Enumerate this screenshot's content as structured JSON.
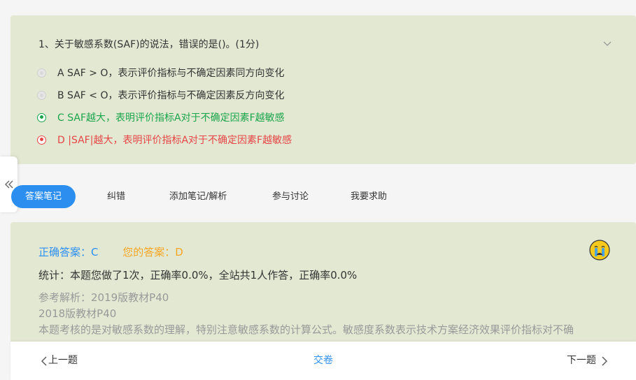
{
  "question": {
    "title": "1、关于敏感系数(SAF)的说法，错误的是()。(1分)",
    "options": [
      {
        "text": "A SAF > O，表示评价指标与不确定因素同方向变化",
        "state": "unselected"
      },
      {
        "text": "B SAF < O，表示评价指标与不确定因素反方向变化",
        "state": "unselected"
      },
      {
        "text": "C SAF越大，表明评价指标A对于不确定因素F越敏感",
        "state": "correct"
      },
      {
        "text": "D |SAF|越大，表明评价指标A对于不确定因素F越敏感",
        "state": "wrong"
      }
    ]
  },
  "tabs": [
    {
      "label": "答案笔记",
      "active": true
    },
    {
      "label": "纠错",
      "active": false
    },
    {
      "label": "添加笔记/解析",
      "active": false
    },
    {
      "label": "参与讨论",
      "active": false
    },
    {
      "label": "我要求助",
      "active": false
    }
  ],
  "answer": {
    "correct_answer": "正确答案：C",
    "your_answer": "您的答案：D",
    "stats": "统计：本题您做了1次，正确率0.0%，全站共1人作答，正确率0.0%",
    "analysis_lines": [
      "参考解析：2019版教材P40",
      "2018版教材P40",
      "本题考核的是对敏感系数的理解，特别注意敏感系数的计算公式。敏感度系数表示技术方案经济效果评价指标对不确"
    ]
  },
  "bottom": {
    "prev": "上一题",
    "submit": "交卷",
    "next": "下一题"
  },
  "colors": {
    "card_bg": "#e3e8d3",
    "accent_blue": "#2c8ff0",
    "correct_green": "#1ba54b",
    "wrong_red": "#e64545",
    "your_answer_orange": "#f5a623"
  }
}
